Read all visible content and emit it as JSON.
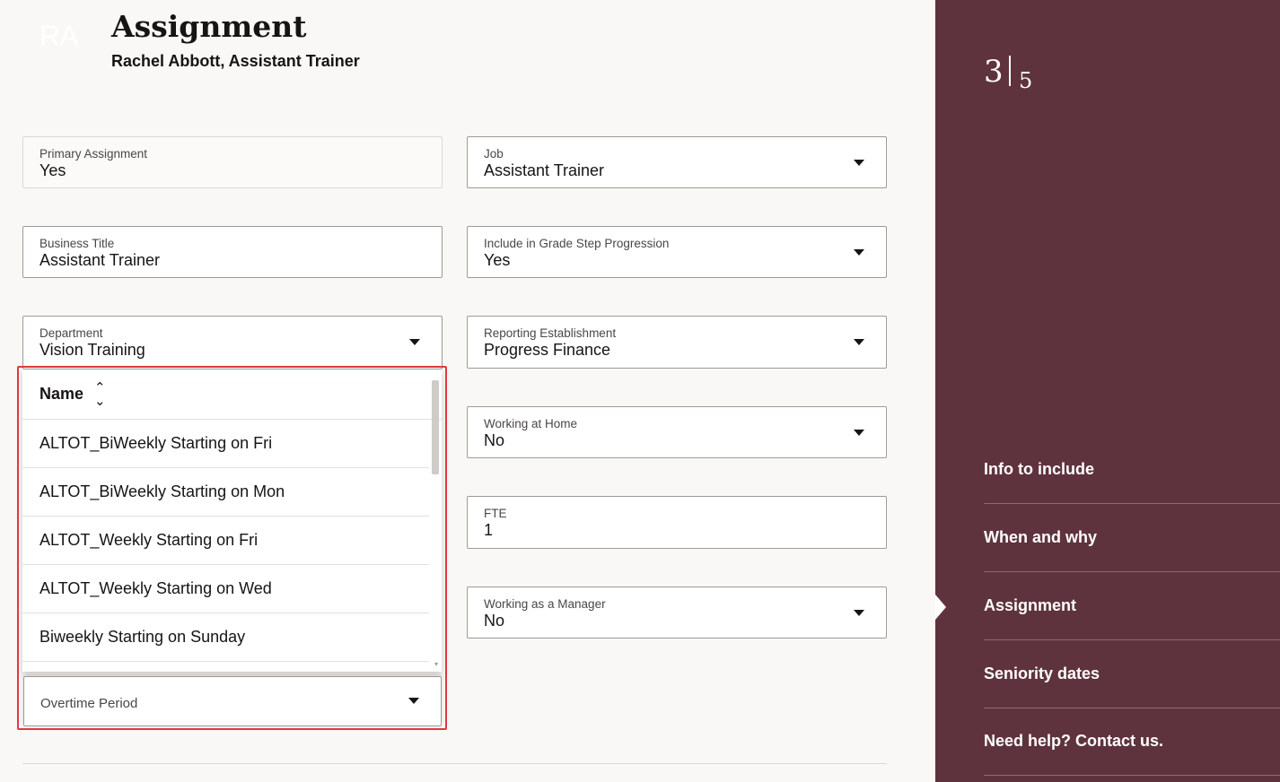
{
  "header": {
    "avatar_initials": "RA",
    "title": "Assignment",
    "subtitle": "Rachel Abbott, Assistant Trainer"
  },
  "fields": {
    "primary_assignment": {
      "label": "Primary Assignment",
      "value": "Yes"
    },
    "job": {
      "label": "Job",
      "value": "Assistant Trainer"
    },
    "business_title": {
      "label": "Business Title",
      "value": "Assistant Trainer"
    },
    "grade_step": {
      "label": "Include in Grade Step Progression",
      "value": "Yes"
    },
    "department": {
      "label": "Department",
      "value": "Vision Training"
    },
    "reporting_establishment": {
      "label": "Reporting Establishment",
      "value": "Progress Finance"
    },
    "working_at_home": {
      "label": "Working at Home",
      "value": "No"
    },
    "fte": {
      "label": "FTE",
      "value": "1"
    },
    "working_as_manager": {
      "label": "Working as a Manager",
      "value": "No"
    },
    "overtime_period": {
      "label": "Overtime Period",
      "value": ""
    }
  },
  "dropdown": {
    "header": "Name",
    "sort_icon": "sort-icon",
    "options": [
      "ALTOT_BiWeekly Starting on Fri",
      "ALTOT_BiWeekly Starting on Mon",
      "ALTOT_Weekly Starting on Fri",
      "ALTOT_Weekly Starting on Wed",
      "Biweekly Starting on Sunday"
    ]
  },
  "stepper": {
    "current": "3",
    "total": "5"
  },
  "nav": {
    "items": [
      "Info to include",
      "When and why",
      "Assignment",
      "Seniority dates",
      "Need help? Contact us."
    ],
    "active_index": 2
  },
  "colors": {
    "sidebar_bg": "#5f333e",
    "highlight_border": "#e0393e",
    "page_bg": "#faf8f6"
  }
}
